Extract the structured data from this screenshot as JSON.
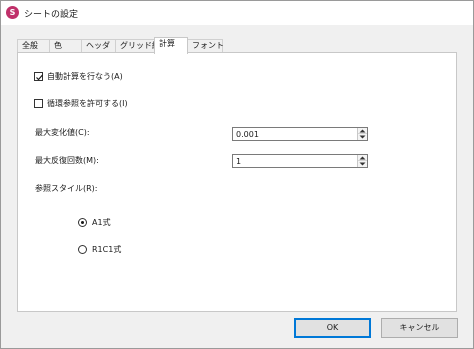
{
  "window": {
    "title": "シートの設定",
    "icon": "app-icon"
  },
  "tabs": [
    {
      "label": "全般",
      "active": false
    },
    {
      "label": "色",
      "active": false
    },
    {
      "label": "ヘッダ",
      "active": false
    },
    {
      "label": "グリッド線",
      "active": false
    },
    {
      "label": "計算",
      "active": true
    },
    {
      "label": "フォント",
      "active": false
    }
  ],
  "calc": {
    "auto_calc_label": "自動計算を行なう(A)",
    "auto_calc_checked": true,
    "circular_ref_label": "循環参照を許可する(I)",
    "circular_ref_checked": false,
    "max_change_label": "最大変化値(C):",
    "max_change_value": "0.001",
    "max_iter_label": "最大反復回数(M):",
    "max_iter_value": "1",
    "ref_style_label": "参照スタイル(R):",
    "ref_styles": [
      {
        "label": "A1式",
        "selected": true
      },
      {
        "label": "R1C1式",
        "selected": false
      }
    ]
  },
  "buttons": {
    "ok_label": "OK",
    "cancel_label": "キャンセル"
  }
}
